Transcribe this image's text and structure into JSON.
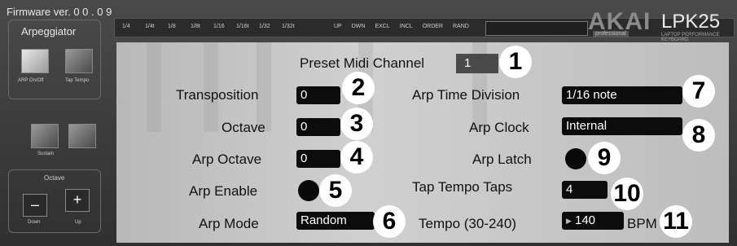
{
  "firmware": "Firmware ver. 0 0 . 0 9",
  "top": {
    "divisions": [
      "1/4",
      "1/4t",
      "1/8",
      "1/8t",
      "1/16",
      "1/16t",
      "1/32",
      "1/32t"
    ],
    "modes": [
      "UP",
      "DWN",
      "EXCL",
      "INCL",
      "ORDER",
      "RAND"
    ]
  },
  "brand": {
    "akai": "AKAI",
    "akai_sub": "professional",
    "lpk": "LPK25",
    "lpk_sub": "LAPTOP PERFORMANCE KEYBOARD"
  },
  "sidebar": {
    "title": "Arpeggiator",
    "arp_onoff": "ARP On/Off",
    "tap_tempo": "Tap Tempo",
    "sustain": "Sustain",
    "octave_title": "Octave",
    "minus": "–",
    "plus": "+",
    "down": "Down",
    "up": "Up"
  },
  "settings": {
    "preset_midi_channel": {
      "label": "Preset Midi Channel",
      "value": "1",
      "num": "1"
    },
    "transposition": {
      "label": "Transposition",
      "value": "0",
      "num": "2"
    },
    "octave": {
      "label": "Octave",
      "value": "0",
      "num": "3"
    },
    "arp_octave": {
      "label": "Arp Octave",
      "value": "0",
      "num": "4"
    },
    "arp_enable": {
      "label": "Arp Enable",
      "num": "5"
    },
    "arp_mode": {
      "label": "Arp Mode",
      "value": "Random",
      "num": "6"
    },
    "arp_time_division": {
      "label": "Arp Time Division",
      "value": "1/16 note",
      "num": "7"
    },
    "arp_clock": {
      "label": "Arp Clock",
      "value": "Internal",
      "num": "8"
    },
    "arp_latch": {
      "label": "Arp Latch",
      "num": "9"
    },
    "tap_tempo_taps": {
      "label": "Tap Tempo Taps",
      "value": "4",
      "num": "10"
    },
    "tempo": {
      "label": "Tempo (30-240)",
      "value": "140",
      "unit": "BPM",
      "num": "11"
    }
  }
}
